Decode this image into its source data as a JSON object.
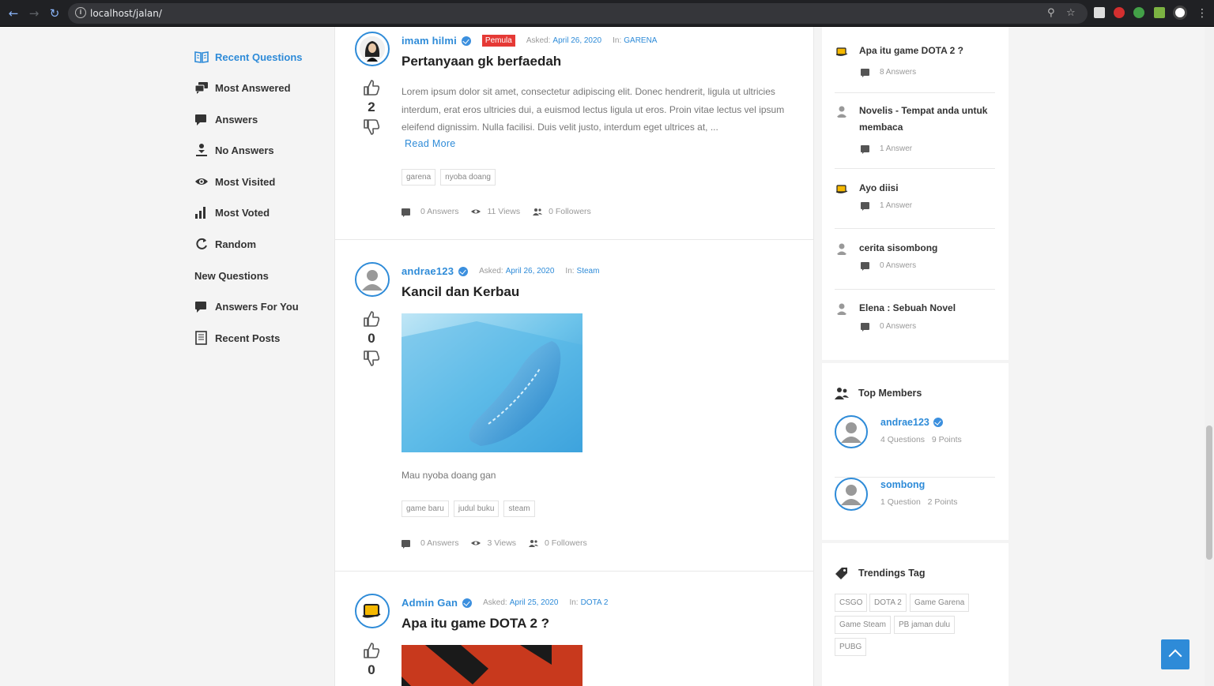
{
  "browser": {
    "url": "localhost/jalan/"
  },
  "nav": {
    "items": [
      {
        "label": "Recent Questions",
        "icon": "book-icon",
        "active": true
      },
      {
        "label": "Most Answered",
        "icon": "comments-icon"
      },
      {
        "label": "Answers",
        "icon": "comment-icon"
      },
      {
        "label": "No Answers",
        "icon": "person-down-icon"
      },
      {
        "label": "Most Visited",
        "icon": "eye-icon"
      },
      {
        "label": "Most Voted",
        "icon": "bar-chart-icon"
      },
      {
        "label": "Random",
        "icon": "refresh-icon"
      },
      {
        "label": "New Questions",
        "icon": ""
      },
      {
        "label": "Answers For You",
        "icon": "comment-icon"
      },
      {
        "label": "Recent Posts",
        "icon": "document-icon"
      }
    ]
  },
  "questions": [
    {
      "author": "imam hilmi",
      "badge": "Pemula",
      "asked_label": "Asked:",
      "date": "April 26, 2020",
      "in_label": "In:",
      "category": "GARENA",
      "votes": "2",
      "title": "Pertanyaan gk berfaedah",
      "excerpt": "Lorem ipsum dolor sit amet, consectetur adipiscing elit. Donec hendrerit, ligula ut ultricies interdum, erat eros ultricies dui, a euismod lectus ligula ut eros. Proin vitae lectus vel ipsum eleifend dignissim. Nulla facilisi. Duis velit justo, interdum eget ultrices at, ...",
      "read_more": "Read More",
      "tags": [
        "garena",
        "nyoba doang"
      ],
      "answers": "0 Answers",
      "views": "11 Views",
      "followers": "0 Followers"
    },
    {
      "author": "andrae123",
      "asked_label": "Asked:",
      "date": "April 26, 2020",
      "in_label": "In:",
      "category": "Steam",
      "votes": "0",
      "title": "Kancil dan Kerbau",
      "excerpt": "Mau nyoba doang gan",
      "tags": [
        "game baru",
        "judul buku",
        "steam"
      ],
      "answers": "0 Answers",
      "views": "3 Views",
      "followers": "0 Followers"
    },
    {
      "author": "Admin Gan",
      "asked_label": "Asked:",
      "date": "April 25, 2020",
      "in_label": "In:",
      "category": "DOTA 2",
      "votes": "0",
      "title": "Apa itu game DOTA 2 ?"
    }
  ],
  "related": [
    {
      "title": "Apa itu game DOTA 2 ?",
      "answers": "8 Answers"
    },
    {
      "title": "Novelis - Tempat anda untuk membaca",
      "answers": "1 Answer"
    },
    {
      "title": "Ayo diisi",
      "answers": "1 Answer"
    },
    {
      "title": "cerita sisombong",
      "answers": "0 Answers"
    },
    {
      "title": "Elena : Sebuah Novel",
      "answers": "0 Answers"
    }
  ],
  "top_members": {
    "title": "Top Members",
    "members": [
      {
        "name": "andrae123",
        "questions": "4 Questions",
        "points": "9 Points"
      },
      {
        "name": "sombong",
        "questions": "1 Question",
        "points": "2 Points"
      }
    ]
  },
  "trending": {
    "title": "Trendings Tag",
    "tags": [
      "CSGO",
      "DOTA 2",
      "Game Garena",
      "Game Steam",
      "PB jaman dulu",
      "PUBG"
    ]
  },
  "colors": {
    "accent": "#2e8bd8",
    "badge": "#e53935"
  }
}
